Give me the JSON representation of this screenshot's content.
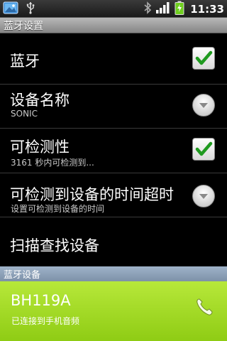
{
  "status_bar": {
    "time": "11:33",
    "icons": [
      "photo-notification-icon",
      "usb-icon",
      "bluetooth-icon",
      "signal-icon",
      "battery-charging-icon"
    ]
  },
  "title_bar": {
    "title": "蓝牙设置"
  },
  "settings": {
    "bluetooth": {
      "title": "蓝牙",
      "checked": true
    },
    "device_name": {
      "title": "设备名称",
      "subtitle": "SONIC"
    },
    "discoverable": {
      "title": "可检测性",
      "subtitle": "3161 秒内可检测到...",
      "checked": true
    },
    "discoverable_timeout": {
      "title": "可检测到设备的时间超时",
      "subtitle": "设置可检测到设备的时间"
    },
    "scan": {
      "title": "扫描查找设备"
    }
  },
  "devices_section": {
    "header": "蓝牙设备",
    "items": [
      {
        "name": "BH119A",
        "status": "已连接到手机音频",
        "icon": "phone-handset-icon"
      }
    ]
  },
  "colors": {
    "check_green": "#1f9a1f",
    "section_blue": "#8ea3ba",
    "device_highlight": "#a6db28"
  }
}
